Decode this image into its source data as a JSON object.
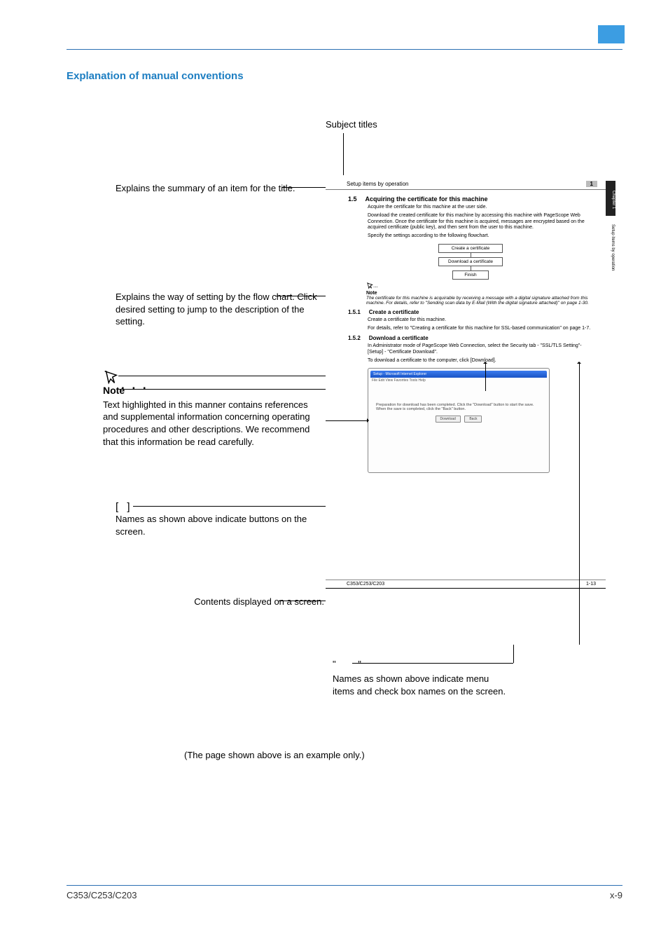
{
  "header": {
    "heading": "Explanation of manual conventions"
  },
  "labels": {
    "subject_titles": "Subject titles",
    "callout_summary": "Explains the summary of an item for  the title.",
    "callout_flow": "Explains the way of setting by the flow chart. Click desired setting to jump to the description of the setting.",
    "note_dots": ". . .",
    "note_title": "Note",
    "note_body": "Text highlighted in this manner contains references and supplemental information concerning operating procedures and other descriptions. We recommend that this information be read carefully.",
    "brackets": "[  ]",
    "callout_buttons": "Names as shown above indicate buttons on the screen.",
    "callout_screen": "Contents displayed on a screen.",
    "quotes": "\"  \"",
    "callout_menus": "Names as shown above indicate menu items and check box names on the screen.",
    "example_only": "(The page shown above is an example only.)"
  },
  "sample_page": {
    "header_left": "Setup items by operation",
    "header_right": "1",
    "chapter_tab": "Chapter 1",
    "side_text": "Setup items by operation",
    "sec_num": "1.5",
    "sec_title": "Acquiring the certificate for this machine",
    "para1": "Acquire the certificate for this machine at the user side.",
    "para2": "Download the created certificate for this machine by accessing this machine with PageScope Web Connection. Once the certificate for this machine is acquired, messages are encrypted based on the acquired certificate (public key), and then sent from the user to this machine.",
    "para3": "Specify the settings according to the following flowchart.",
    "flow": [
      "Create a certificate",
      "Download a certificate",
      "Finish"
    ],
    "note_label": "Note",
    "note_text": "The certificate for this machine is acquirable by receiving a message with a digital signature attached from this machine. For details, refer to \"Sending scan data by E-Mail (With the digital signature attached)\" on page 1-30.",
    "sub1_num": "1.5.1",
    "sub1_title": "Create a certificate",
    "sub1_p1": "Create a certificate for this machine.",
    "sub1_p2": "For details, refer to \"Creating a certificate for this machine for SSL-based communication\" on page 1-7.",
    "sub2_num": "1.5.2",
    "sub2_title": "Download a certificate",
    "sub2_p1": "In Administrator mode of PageScope Web Connection, select the Security tab - \"SSL/TLS Setting\"- [Setup] - \"Certificate Download\".",
    "sub2_p2": "To download a certificate to the computer, click [Download].",
    "screenshot": {
      "bar": "Setup - Microsoft Internet Explorer",
      "menu": "File  Edit  View  Favorites  Tools  Help",
      "msg": "Preparation for download has been completed. Click the \"Download\" button to start the save. When the save is completed, click the \"Back\" button.",
      "btn1": "Download",
      "btn2": "Back"
    },
    "footer_left": "C353/C253/C203",
    "footer_right": "1-13"
  },
  "footer": {
    "left": "C353/C253/C203",
    "right": "x-9"
  }
}
